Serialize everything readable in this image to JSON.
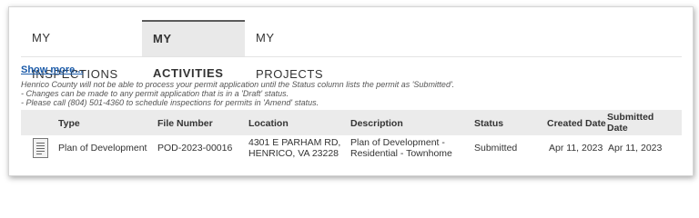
{
  "tabs": [
    {
      "label": "MY INSPECTIONS"
    },
    {
      "label": "MY ACTIVITIES",
      "active": true
    },
    {
      "label": "MY PROJECTS"
    }
  ],
  "show_more": "Show more...",
  "notes": [
    "Henrico County will not be able to process your permit application until the Status column lists the permit as 'Submitted'.",
    "- Changes can be made to any permit application that is in a 'Draft' status.",
    "- Please call (804) 501-4360 to schedule inspections for permits in 'Amend' status."
  ],
  "columns": {
    "type": "Type",
    "file_number": "File Number",
    "location": "Location",
    "description": "Description",
    "status": "Status",
    "created_date": "Created Date",
    "submitted_date_1": "Submitted",
    "submitted_date_2": "Date"
  },
  "rows": [
    {
      "icon": "document-icon",
      "type": "Plan of Development",
      "file_number": "POD-2023-00016",
      "location_1": "4301 E PARHAM RD,",
      "location_2": "HENRICO, VA 23228",
      "description_1": "Plan of Development -",
      "description_2": "Residential - Townhome",
      "status": "Submitted",
      "created_date": "Apr 11, 2023",
      "submitted_date": "Apr 11, 2023"
    }
  ],
  "colors": {
    "link": "#1a5aa8",
    "active_tab_bg": "#e9e9e9",
    "header_bg": "#ebebeb"
  }
}
